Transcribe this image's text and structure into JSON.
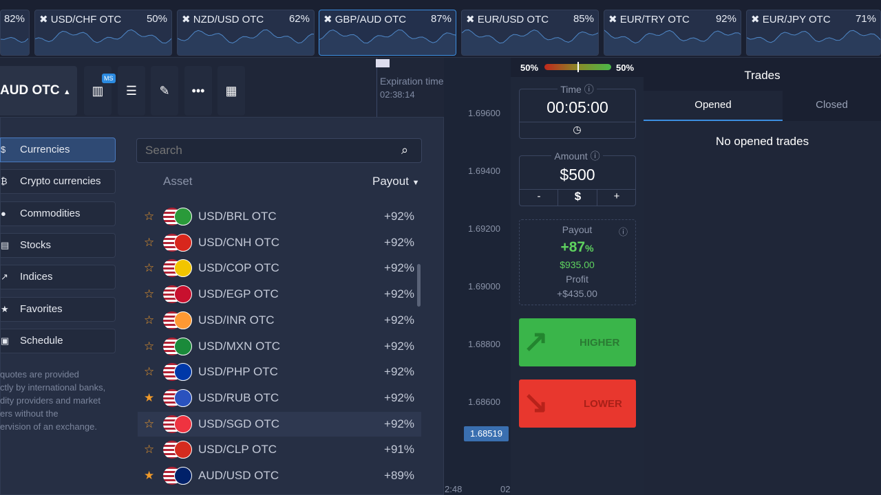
{
  "tickers": [
    {
      "name": "",
      "payout": "82%"
    },
    {
      "name": "USD/CHF OTC",
      "payout": "50%"
    },
    {
      "name": "NZD/USD OTC",
      "payout": "62%"
    },
    {
      "name": "GBP/AUD OTC",
      "payout": "87%",
      "active": true
    },
    {
      "name": "EUR/USD OTC",
      "payout": "85%"
    },
    {
      "name": "EUR/TRY OTC",
      "payout": "92%"
    },
    {
      "name": "EUR/JPY OTC",
      "payout": "71%"
    }
  ],
  "toolbar": {
    "asset": "AUD OTC",
    "badge": "MS"
  },
  "chart": {
    "expiration_label": "Expiration time",
    "expiration_value": "02:38:14",
    "prices": [
      "1.69600",
      "1.69400",
      "1.69200",
      "1.69000",
      "1.68800",
      "1.68600"
    ],
    "current_price": "1.68519",
    "time_labels": [
      "2:48",
      "02"
    ]
  },
  "categories": [
    {
      "label": "Currencies",
      "icon": "$",
      "active": true
    },
    {
      "label": "Crypto currencies",
      "icon": "₿"
    },
    {
      "label": "Commodities",
      "icon": "●"
    },
    {
      "label": "Stocks",
      "icon": "▤"
    },
    {
      "label": "Indices",
      "icon": "↗"
    },
    {
      "label": "Favorites",
      "icon": "★"
    },
    {
      "label": "Schedule",
      "icon": "▣"
    }
  ],
  "note": "quotes are provided\nctly by international banks,\ndity providers and market\ners without the\nervision of an exchange.",
  "search": {
    "placeholder": "Search"
  },
  "list_header": {
    "asset": "Asset",
    "payout": "Payout"
  },
  "assets": [
    {
      "name": "USD/BRL OTC",
      "payout": "+92%",
      "fav": false,
      "flag": "#2a9a3a"
    },
    {
      "name": "USD/CNH OTC",
      "payout": "+92%",
      "fav": false,
      "flag": "#d8261c"
    },
    {
      "name": "USD/COP OTC",
      "payout": "+92%",
      "fav": false,
      "flag": "#f2c500"
    },
    {
      "name": "USD/EGP OTC",
      "payout": "+92%",
      "fav": false,
      "flag": "#c8102e"
    },
    {
      "name": "USD/INR OTC",
      "payout": "+92%",
      "fav": false,
      "flag": "#ff9933"
    },
    {
      "name": "USD/MXN OTC",
      "payout": "+92%",
      "fav": false,
      "flag": "#1a8a3a"
    },
    {
      "name": "USD/PHP OTC",
      "payout": "+92%",
      "fav": false,
      "flag": "#0038a8"
    },
    {
      "name": "USD/RUB OTC",
      "payout": "+92%",
      "fav": true,
      "flag": "#2a52be"
    },
    {
      "name": "USD/SGD OTC",
      "payout": "+92%",
      "fav": false,
      "flag": "#ef3340",
      "highlighted": true
    },
    {
      "name": "USD/CLP OTC",
      "payout": "+91%",
      "fav": false,
      "flag": "#d52b1e"
    },
    {
      "name": "AUD/USD OTC",
      "payout": "+89%",
      "fav": true,
      "flag": "#012169"
    }
  ],
  "trade": {
    "sentiment_left": "50%",
    "sentiment_right": "50%",
    "sentiment": 50,
    "time_label": "Time",
    "time_value": "00:05:00",
    "amount_label": "Amount",
    "amount_value": "$500",
    "minus": "-",
    "currency": "$",
    "plus": "+",
    "payout_label": "Payout",
    "payout_pct": "+87",
    "pct_sign": "%",
    "payout_amount": "$935.00",
    "profit_label": "Profit",
    "profit_value": "+$435.00",
    "higher": "HIGHER",
    "lower": "LOWER"
  },
  "trades": {
    "title": "Trades",
    "tabs": [
      "Opened",
      "Closed"
    ],
    "empty": "No opened trades"
  },
  "colors": {
    "accent": "#3c8ee0",
    "higher": "#3ab54a",
    "lower": "#e8372e",
    "payout_green": "#5fd35f"
  }
}
